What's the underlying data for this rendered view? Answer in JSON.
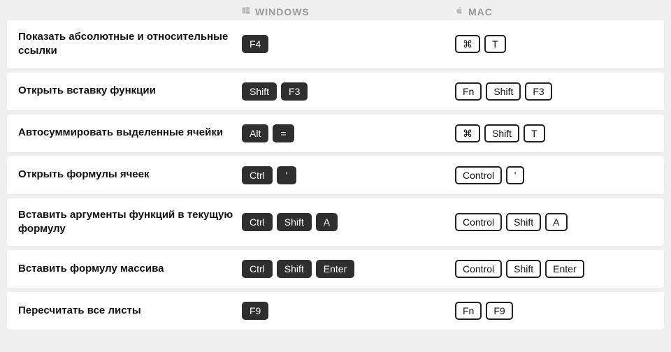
{
  "header": {
    "windows_label": "WINDOWS",
    "mac_label": "MAC"
  },
  "shortcuts": [
    {
      "action": "Показать абсолютные и относительные ссылки",
      "win": [
        "F4"
      ],
      "mac": [
        "⌘",
        "T"
      ]
    },
    {
      "action": "Открыть вставку функции",
      "win": [
        "Shift",
        "F3"
      ],
      "mac": [
        "Fn",
        "Shift",
        "F3"
      ]
    },
    {
      "action": "Автосуммировать выделенные ячейки",
      "win": [
        "Alt",
        "="
      ],
      "mac": [
        "⌘",
        "Shift",
        "T"
      ]
    },
    {
      "action": "Открыть формулы ячеек",
      "win": [
        "Ctrl",
        "'"
      ],
      "mac": [
        "Control",
        "'"
      ]
    },
    {
      "action": "Вставить аргументы функций в текущую формулу",
      "win": [
        "Ctrl",
        "Shift",
        "A"
      ],
      "mac": [
        "Control",
        "Shift",
        "A"
      ]
    },
    {
      "action": "Вставить формулу массива",
      "win": [
        "Ctrl",
        "Shift",
        "Enter"
      ],
      "mac": [
        "Control",
        "Shift",
        "Enter"
      ]
    },
    {
      "action": "Пересчитать все листы",
      "win": [
        "F9"
      ],
      "mac": [
        "Fn",
        "F9"
      ]
    }
  ]
}
